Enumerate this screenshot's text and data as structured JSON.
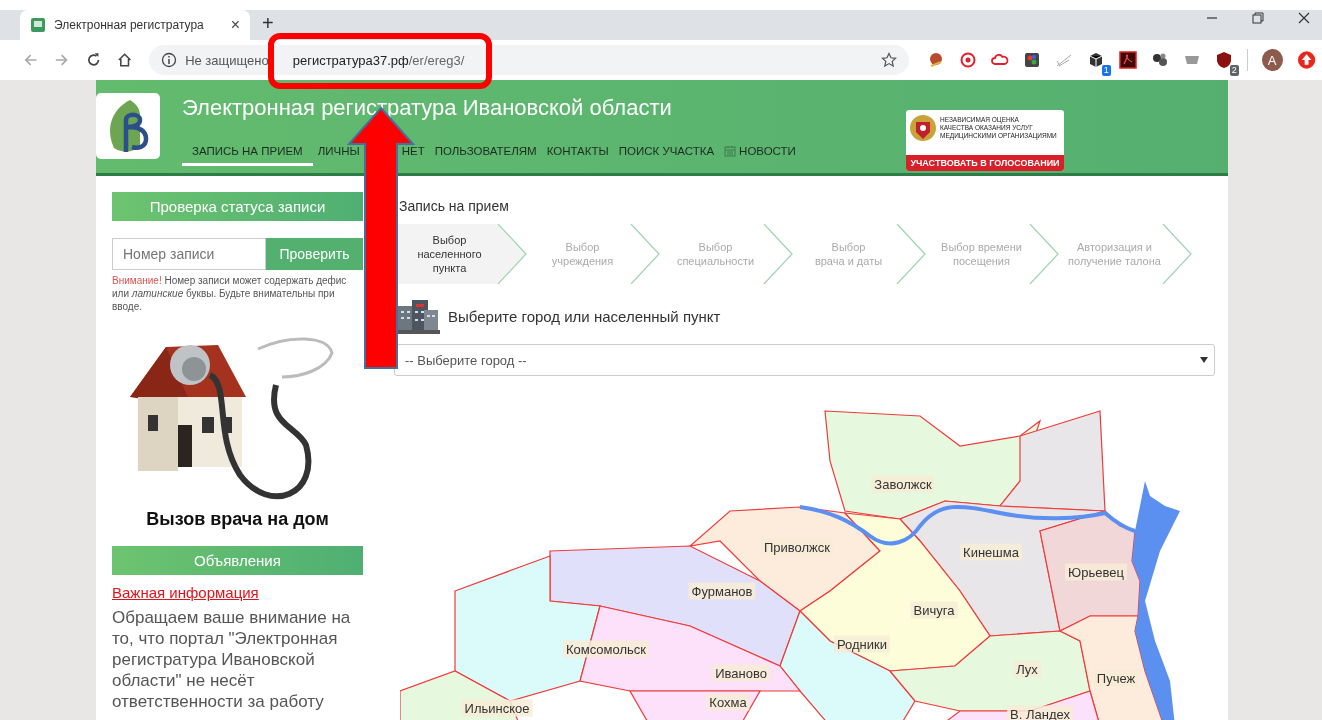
{
  "browser": {
    "tab": {
      "title": "Электронная регистратура",
      "close": "×"
    },
    "new_tab": "+",
    "address": {
      "security": "Не защищено",
      "host": "регистратура37.рф",
      "path": "/er/ereg3/"
    },
    "extensions": [
      {
        "kind": "mask"
      },
      {
        "kind": "ring"
      },
      {
        "kind": "cloud"
      },
      {
        "kind": "tile"
      },
      {
        "kind": "lines"
      },
      {
        "kind": "cube",
        "badge": "1"
      },
      {
        "kind": "pdf"
      },
      {
        "kind": "balls"
      },
      {
        "kind": "dish"
      },
      {
        "kind": "shield",
        "badge": "2"
      }
    ],
    "profile": "A"
  },
  "header": {
    "title": "Электронная регистратура Ивановской области",
    "nav": [
      {
        "kind": "text",
        "label": "ЗАПИСЬ НА ПРИЕМ",
        "selected": true
      },
      {
        "kind": "covered",
        "label": "ЛИЧНЫ",
        "label_end": "НЕТ",
        "selected": false
      },
      {
        "kind": "text",
        "label": "ПОЛЬЗОВАТЕЛЯМ",
        "selected": false
      },
      {
        "kind": "text",
        "label": "КОНТАКТЫ",
        "selected": false
      },
      {
        "kind": "text",
        "label": "ПОИСК УЧАСТКА",
        "selected": false
      },
      {
        "kind": "calendar",
        "label": "НОВОСТИ",
        "selected": false
      }
    ],
    "survey": {
      "lines": [
        "НЕЗАВИСИМАЯ ОЦЕНКА",
        "КАЧЕСТВА ОКАЗАНИЯ УСЛУГ",
        "МЕДИЦИНСКИМИ ОРГАНИЗАЦИЯМИ"
      ],
      "action": "УЧАСТВОВАТЬ В ГОЛОСОВАНИИ"
    }
  },
  "sidebar": {
    "status_title": "Проверка статуса записи",
    "record_field": {
      "placeholder": "Номер записи"
    },
    "check_button": "Проверить",
    "note": {
      "label": "Внимание!",
      "text": "Номер записи может содержать дефис или *латинские* буквы. Будьте внимательны при вводе."
    },
    "promo": {
      "kind": "picture",
      "caption": "Вызов врача на дом"
    },
    "news_title": "Объявления",
    "news_link": "Важная информация",
    "news_text": "Обращаем ваше внимание на то, что портал \"Электронная регистратура Ивановской области\" не несёт ответственности за работу"
  },
  "main": {
    "title": "Запись на прием",
    "steps": [
      {
        "label": "Выбор\nнаселенного пункта",
        "selected": true
      },
      {
        "label": "Выбор\nучреждения",
        "selected": false
      },
      {
        "label": "Выбор\nспециальности",
        "selected": false
      },
      {
        "label": "Выбор\nврача и даты",
        "selected": false
      },
      {
        "label": "Выбор времени\nпосещения",
        "selected": false
      },
      {
        "label": "Авторизация и\nполучение талона",
        "selected": false
      }
    ],
    "section_title": "Выберите город или населенный пункт",
    "city_select": {
      "value": "-- Выберите город --"
    },
    "map": {
      "regions": [
        {
          "label": "Заволжск",
          "color": "#e6f9df"
        },
        {
          "color": "#e8e6e8"
        },
        {
          "label": "Кинешма",
          "color": "#e8e6e8"
        },
        {
          "label": "Юрьевец",
          "color": "#f2d7d9"
        },
        {
          "label": "Приволжск",
          "color": "#fdecdc"
        },
        {
          "label": "Фурманов",
          "color": "#e0e0fb"
        },
        {
          "label": "Вичуга",
          "color": "#fdfdd9"
        },
        {
          "label": "Родники",
          "color": "#dbfbfb"
        },
        {
          "label": "Комсомольск",
          "color": "#dbfbfb"
        },
        {
          "label": "Иваново",
          "color": "#fde0f9"
        },
        {
          "label": "Лух",
          "color": "#e6f9df"
        },
        {
          "label": "Пучеж",
          "color": "#fdecdc"
        },
        {
          "label": "Ильинское",
          "color": "#e6f9df"
        },
        {
          "label": "Кохма",
          "color": "#fde0f9"
        },
        {
          "label": "В. Ландех",
          "color": "#fde0f9"
        }
      ]
    }
  }
}
